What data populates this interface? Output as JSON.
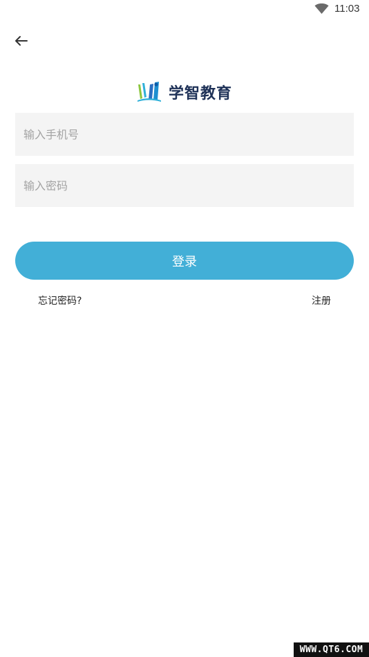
{
  "status_bar": {
    "time": "11:03",
    "wifi_icon": "wifi-icon"
  },
  "header": {
    "back_icon": "arrow-left-icon"
  },
  "logo": {
    "text": "学智教育"
  },
  "form": {
    "phone_placeholder": "输入手机号",
    "phone_value": "",
    "password_placeholder": "输入密码",
    "password_value": "",
    "login_label": "登录",
    "forgot_label": "忘记密码?",
    "register_label": "注册"
  },
  "watermark": {
    "text": "WWW.QT6.COM"
  },
  "colors": {
    "accent": "#42afd7",
    "field_bg": "#f4f4f4",
    "logo_text": "#1e3157"
  }
}
